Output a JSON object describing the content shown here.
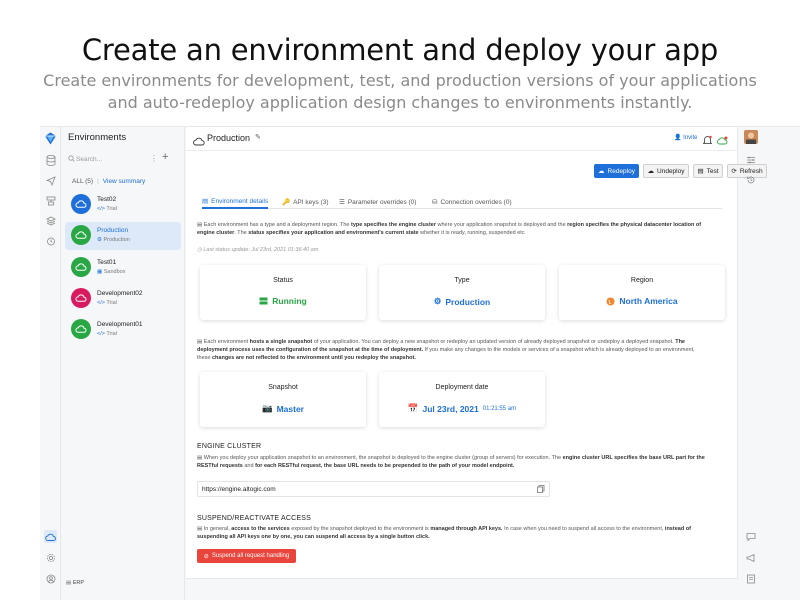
{
  "hero": {
    "title": "Create an environment and deploy your app",
    "subtitle": "Create environments for development, test, and production versions of your applications and auto-redeploy application design changes to environments instantly."
  },
  "env_panel": {
    "title": "Environments",
    "search_placeholder": "Search...",
    "filter_all": "ALL (5)",
    "filter_sep": "|",
    "view_summary": "View summary",
    "items": [
      {
        "name": "Test02",
        "type": "Trial",
        "color": "#1e6fd9"
      },
      {
        "name": "Production",
        "type": "Production",
        "color": "#2aa745"
      },
      {
        "name": "Test01",
        "type": "Sandbox",
        "color": "#2aa745"
      },
      {
        "name": "Development02",
        "type": "Trial",
        "color": "#d81b60"
      },
      {
        "name": "Development01",
        "type": "Trial",
        "color": "#2aa745"
      }
    ],
    "footer": "ERP"
  },
  "header": {
    "title": "Production",
    "invite": "Invite"
  },
  "actions": {
    "redeploy": "Redeploy",
    "undeploy": "Undeploy",
    "test": "Test",
    "refresh": "Refresh"
  },
  "tabs": [
    {
      "label": "Environment details"
    },
    {
      "label": "API keys (3)"
    },
    {
      "label": "Parameter overrides (0)"
    },
    {
      "label": "Connection overrides (0)"
    }
  ],
  "details": {
    "desc1_a": "Each environment has a type and a deployment region. The ",
    "desc1_b": "type specifies the engine cluster",
    "desc1_c": " where your application snapshot is deployed and the ",
    "desc1_d": "region specifies the physical datacenter location of engine cluster",
    "desc1_e": ". The ",
    "desc1_f": "status specifies your application and environment's current state",
    "desc1_g": " whether it is ready, running, suspended etc",
    "last_update": "Last status update: Jul 23rd, 2021 01:36:40 am",
    "status_label": "Status",
    "status_value": "Running",
    "type_label": "Type",
    "type_value": "Production",
    "region_label": "Region",
    "region_value": "North America",
    "desc2_a": "Each environment ",
    "desc2_b": "hosts a single snapshot",
    "desc2_c": " of your application. You can deploy a new snapshot or redeploy an updated version of already deployed snapshot or undeploy a deployed snapshot. ",
    "desc2_d": "The deployment process uses the configuration of the snapshot at the time of deployment.",
    "desc2_e": " If you make any changes to the models or services of a snapshot which is already deployed to an environment, these ",
    "desc2_f": "changes are not reflected to the environment until you redeploy the snapshot.",
    "snapshot_label": "Snapshot",
    "snapshot_value": "Master",
    "deploy_label": "Deployment date",
    "deploy_date": "Jul 23rd, 2021",
    "deploy_time": "01:21:55 am"
  },
  "engine": {
    "heading": "ENGINE CLUSTER",
    "desc_a": "When you deploy your application snapshot to an environment, the snapshot is deployed to the engine cluster (group of servers) for execution. The ",
    "desc_b": "engine cluster URL specifies the base URL part for the RESTful requests",
    "desc_c": " and ",
    "desc_d": "for each RESTful request, the base URL needs to be prepended to the path of your model endpoint.",
    "url": "https://engine.altogic.com"
  },
  "suspend": {
    "heading": "SUSPEND/REACTIVATE ACCESS",
    "desc_a": "In general, ",
    "desc_b": "access to the services",
    "desc_c": " exposed by the snapshot deployed to the environment is ",
    "desc_d": "managed through API keys.",
    "desc_e": " In case when you need to suspend all access to the environment, ",
    "desc_f": "instead of suspending all API keys one by one, you can suspend all access by a single button click.",
    "button": "Suspend all request handling"
  },
  "colors": {
    "accent": "#1e6fd9",
    "running": "#2aa745",
    "danger": "#e8453c",
    "region_orange": "#f0862e"
  }
}
